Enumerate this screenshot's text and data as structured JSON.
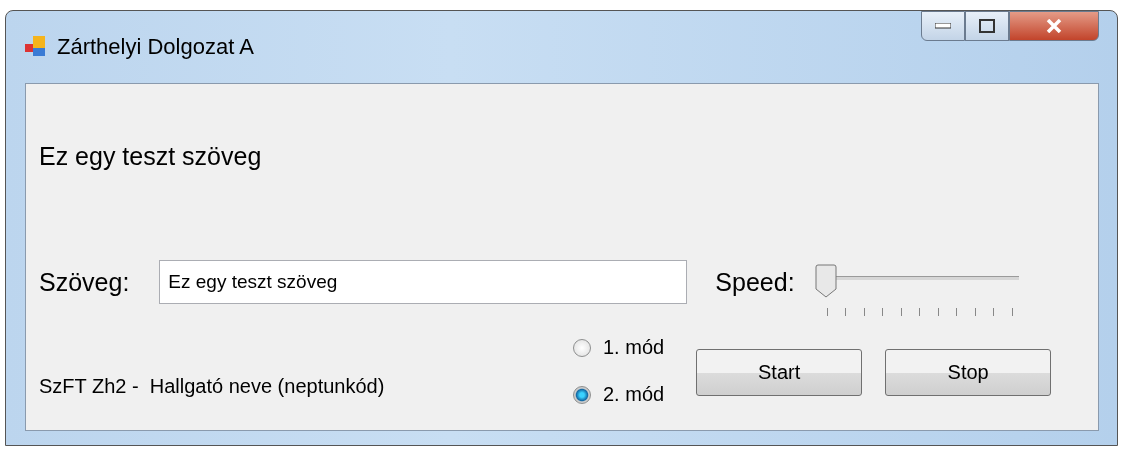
{
  "window": {
    "title": "Zárthelyi Dolgozat A"
  },
  "heading": "Ez egy teszt szöveg",
  "text_field": {
    "label": "Szöveg:",
    "value": "Ez egy teszt szöveg"
  },
  "speed": {
    "label": "Speed:",
    "level": 0
  },
  "modes": [
    {
      "label": "1. mód",
      "selected": false
    },
    {
      "label": "2. mód",
      "selected": true
    }
  ],
  "footer_label": "SzFT Zh2 -  Hallgató neve (neptunkód)",
  "buttons": [
    "Start",
    "Stop"
  ]
}
